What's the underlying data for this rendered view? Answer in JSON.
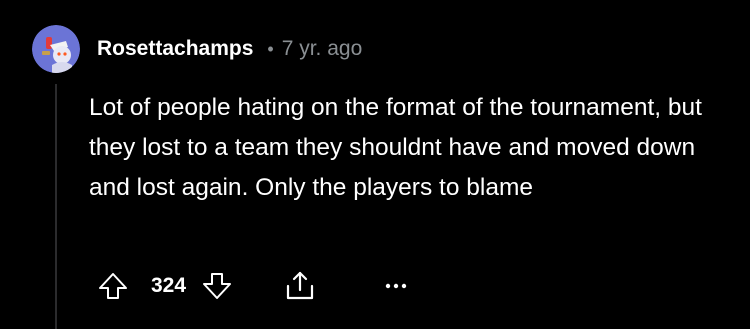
{
  "comment": {
    "author": "Rosettachamps",
    "separator": "•",
    "timestamp": "7 yr. ago",
    "body": "Lot of people hating on the format of the tournament, but they lost to a team they shouldnt have and moved down and lost again. Only the players to blame",
    "vote_count": "324"
  },
  "icons": {
    "upvote": "arrow-up-outline-icon",
    "downvote": "arrow-down-outline-icon",
    "share": "share-icon",
    "more": "ellipsis-icon"
  },
  "colors": {
    "background": "#000000",
    "text": "#ffffff",
    "muted": "#8a8f93",
    "thread_line": "#2b2b2d",
    "avatar_bg": "#6b74d6"
  }
}
